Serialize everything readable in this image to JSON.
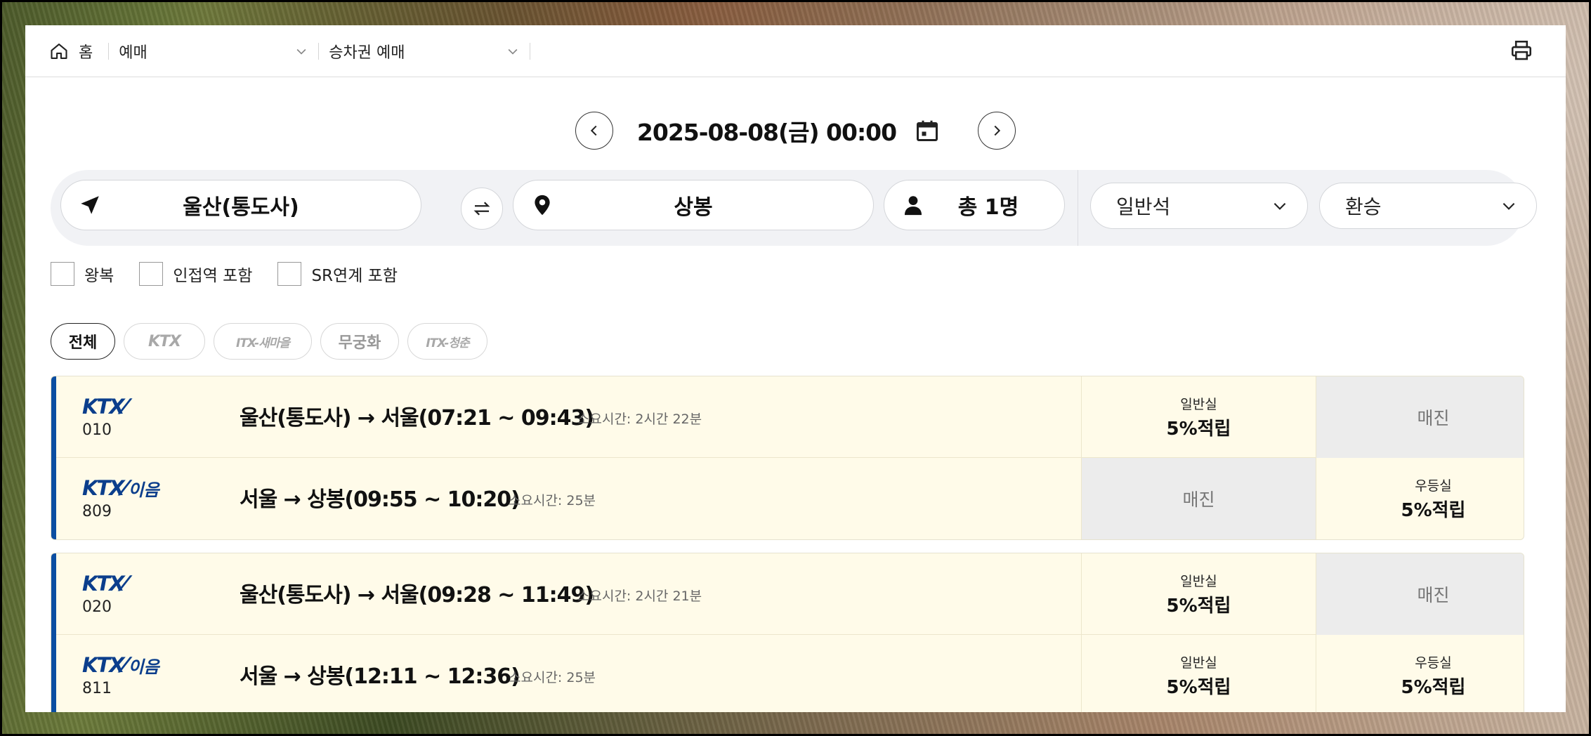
{
  "breadcrumb": {
    "home": "홈",
    "menu1": "예매",
    "menu2": "승차권 예매"
  },
  "date": {
    "value": "2025-08-08(금) 00:00"
  },
  "search": {
    "departure": "울산(통도사)",
    "arrival": "상봉",
    "passengers": "총 1명",
    "seat_class": "일반석",
    "transfer": "환승"
  },
  "options": {
    "round_trip": "왕복",
    "nearby": "인접역 포함",
    "sr_link": "SR연계 포함"
  },
  "filters": {
    "all": "전체",
    "ktx": "KTX",
    "itx_saemaeul": "ITX-새마을",
    "mugunghwa": "무궁화",
    "itx_cheongchun": "ITX-청춘"
  },
  "trains": [
    {
      "legs": [
        {
          "logo": "KTX",
          "number": "010",
          "route": "울산(통도사) → 서울(07:21 ~ 09:43)",
          "duration": "소요시간: 2시간 22분",
          "cell1": {
            "class": "일반실",
            "status": "5%적립",
            "sold_out": false
          },
          "cell2": {
            "class": "",
            "status": "매진",
            "sold_out": true
          }
        },
        {
          "logo": "KTX-이음",
          "number": "809",
          "route": "서울 → 상봉(09:55 ~ 10:20)",
          "duration": "소요시간: 25분",
          "cell1": {
            "class": "",
            "status": "매진",
            "sold_out": true
          },
          "cell2": {
            "class": "우등실",
            "status": "5%적립",
            "sold_out": false
          }
        }
      ]
    },
    {
      "legs": [
        {
          "logo": "KTX",
          "number": "020",
          "route": "울산(통도사) → 서울(09:28 ~ 11:49)",
          "duration": "소요시간: 2시간 21분",
          "cell1": {
            "class": "일반실",
            "status": "5%적립",
            "sold_out": false
          },
          "cell2": {
            "class": "",
            "status": "매진",
            "sold_out": true
          }
        },
        {
          "logo": "KTX-이음",
          "number": "811",
          "route": "서울 → 상봉(12:11 ~ 12:36)",
          "duration": "소요시간: 25분",
          "cell1": {
            "class": "일반실",
            "status": "5%적립",
            "sold_out": false
          },
          "cell2": {
            "class": "우등실",
            "status": "5%적립",
            "sold_out": false
          }
        }
      ]
    }
  ],
  "colors": {
    "row_bg": "#fffbe9",
    "sold_bg": "#ececec",
    "accent_bar": "#0b4ea2",
    "ktx_blue": "#0b3e8c",
    "ktx_red": "#d0202c"
  }
}
